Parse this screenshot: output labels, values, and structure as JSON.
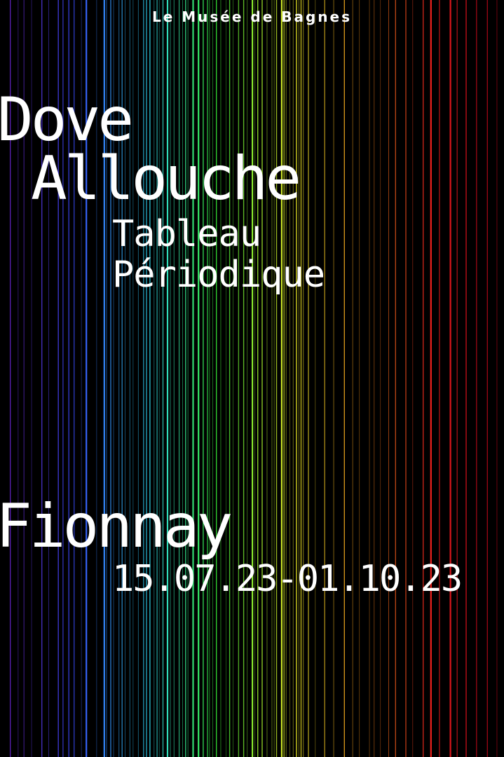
{
  "museum": "Le Musée de Bagnes",
  "artist": {
    "first_name": "Dove",
    "last_name": "Allouche"
  },
  "title": {
    "line1": "Tableau",
    "line2": "Périodique"
  },
  "location": "Fionnay",
  "dates": "15.07.23-01.10.23",
  "colors": {
    "background": "#000000",
    "text": "#ffffff",
    "spectrum": [
      "#8b2cff",
      "#3a4bff",
      "#2fd8ff",
      "#3cff3c",
      "#f5ff2a",
      "#ff9a1a",
      "#ff2020",
      "#b00018"
    ]
  }
}
